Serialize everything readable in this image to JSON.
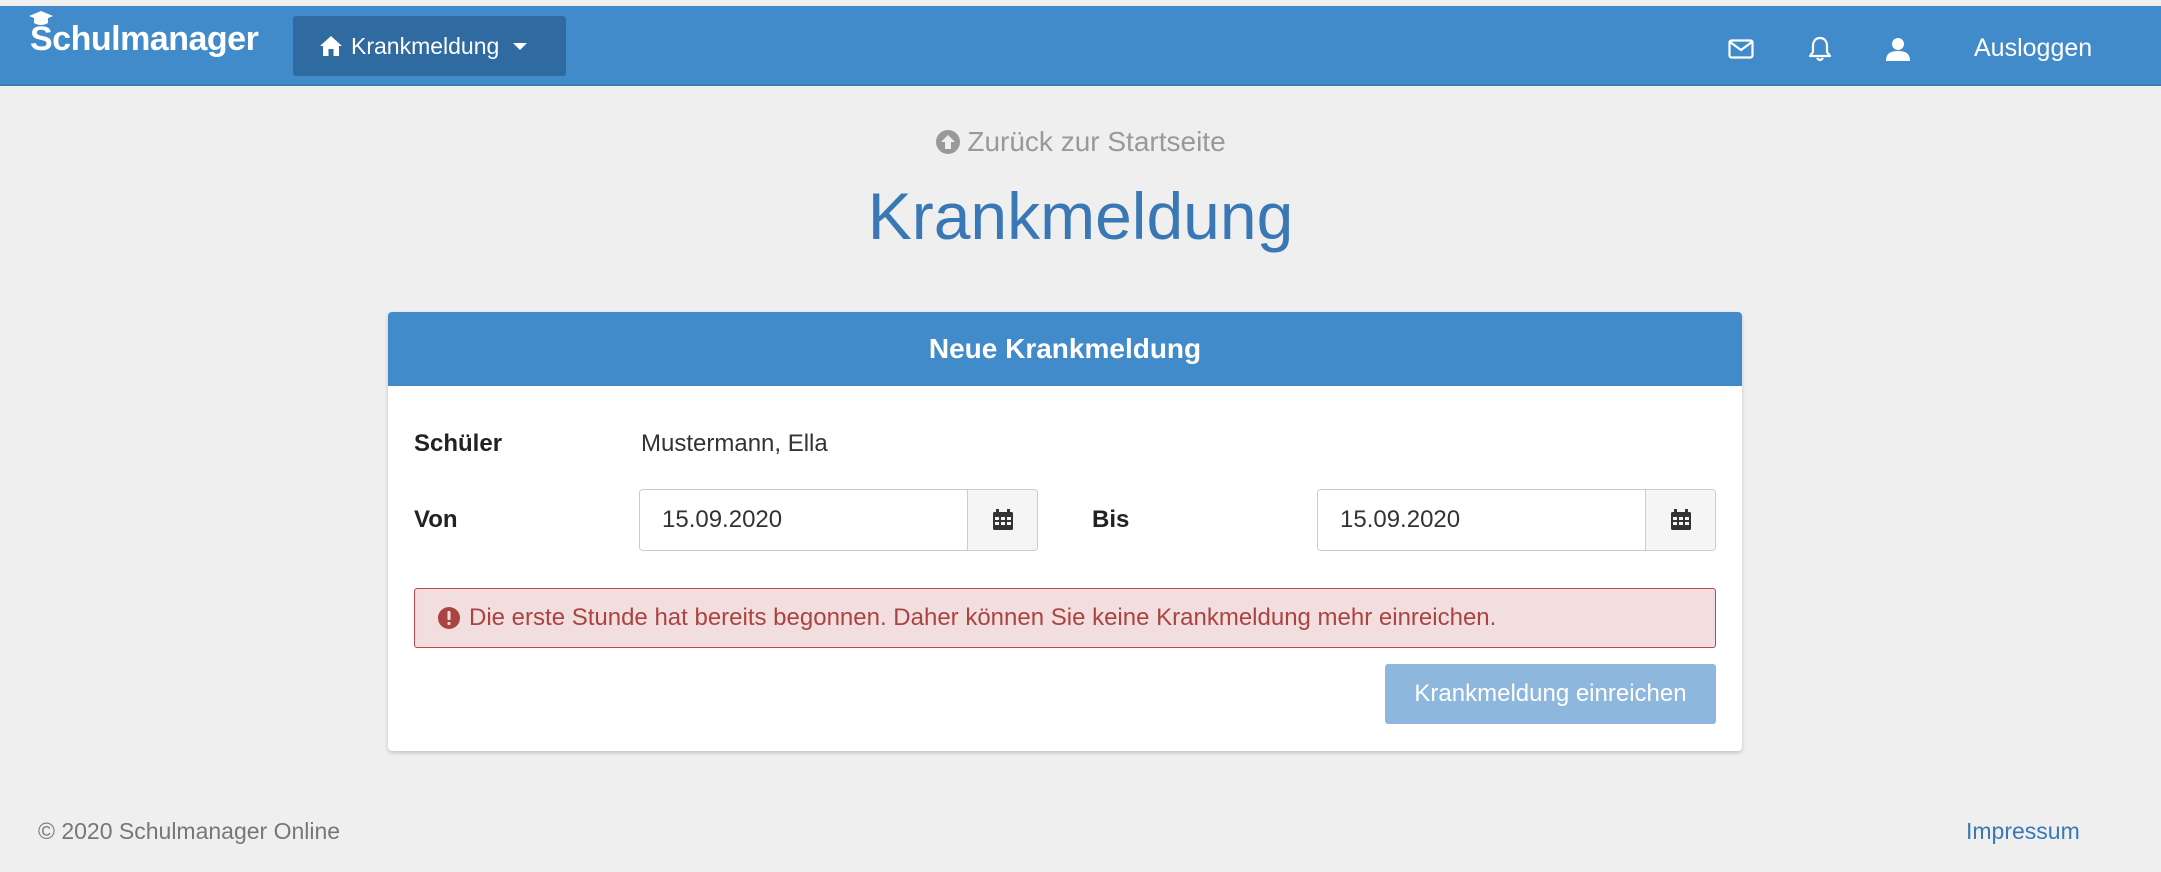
{
  "app": {
    "brand": "Schulmanager"
  },
  "nav": {
    "menu_label": "Krankmeldung",
    "logout_label": "Ausloggen"
  },
  "page": {
    "back_link": "Zurück zur Startseite",
    "title": "Krankmeldung"
  },
  "form": {
    "panel_title": "Neue Krankmeldung",
    "student_label": "Schüler",
    "student_value": "Mustermann, Ella",
    "from_label": "Von",
    "from_value": "15.09.2020",
    "to_label": "Bis",
    "to_value": "15.09.2020",
    "alert_text": "Die erste Stunde hat bereits begonnen. Daher können Sie keine Krankmeldung mehr einreichen.",
    "submit_label": "Krankmeldung einreichen",
    "submit_disabled": true
  },
  "footer": {
    "copyright": "© 2020 Schulmanager Online",
    "impressum": "Impressum"
  },
  "colors": {
    "primary": "#428bca",
    "nav_active": "#2f6aa0",
    "title": "#3a78b5",
    "alert_bg": "#f2dede",
    "alert_text": "#a94442",
    "button_disabled": "#8db7dd"
  },
  "icons": {
    "brand": "graduation-cap-icon",
    "menu": "home-icon",
    "messages": "envelope-icon",
    "notifications": "bell-icon",
    "profile": "user-icon",
    "back": "circle-arrow-up-icon",
    "date": "calendar-icon",
    "alert": "exclamation-circle-icon"
  }
}
